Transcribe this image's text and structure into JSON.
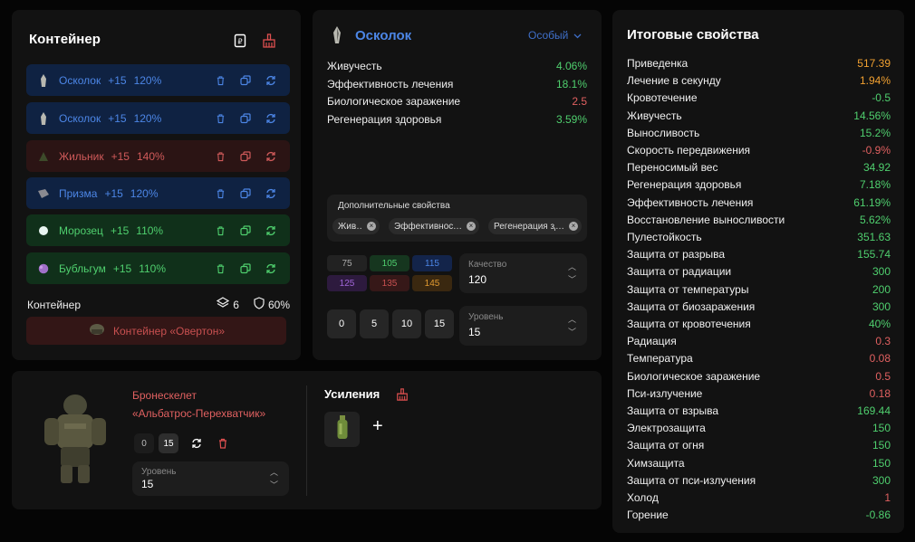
{
  "container": {
    "title": "Контейнер",
    "artifacts": [
      {
        "name": "Осколок",
        "level": "+15",
        "percent": "120%",
        "color": "blue"
      },
      {
        "name": "Осколок",
        "level": "+15",
        "percent": "120%",
        "color": "blue"
      },
      {
        "name": "Жильник",
        "level": "+15",
        "percent": "140%",
        "color": "red"
      },
      {
        "name": "Призма",
        "level": "+15",
        "percent": "120%",
        "color": "blue"
      },
      {
        "name": "Морозец",
        "level": "+15",
        "percent": "110%",
        "color": "green"
      },
      {
        "name": "Бубльгум",
        "level": "+15",
        "percent": "110%",
        "color": "green"
      }
    ],
    "footer_label": "Контейнер",
    "slots": "6",
    "protection": "60%",
    "container_button": "Контейнер «Овертон»"
  },
  "item": {
    "name": "Осколок",
    "rarity": "Особый",
    "stats": [
      {
        "label": "Живучесть",
        "value": "4.06%",
        "tone": "g"
      },
      {
        "label": "Эффективность лечения",
        "value": "18.1%",
        "tone": "g"
      },
      {
        "label": "Биологическое заражение",
        "value": "2.5",
        "tone": "r"
      },
      {
        "label": "Регенерация здоровья",
        "value": "3.59%",
        "tone": "g"
      }
    ],
    "additional_title": "Дополнительные свойства",
    "chips": [
      "Живучесть",
      "Эффективность лечения",
      "Регенерация здоровья"
    ],
    "quality_buttons": [
      "75",
      "105",
      "115",
      "125",
      "135",
      "145"
    ],
    "quality_label": "Качество",
    "quality_value": "120",
    "level_buttons": [
      "0",
      "5",
      "10",
      "15"
    ],
    "level_label": "Уровень",
    "level_value": "15"
  },
  "armor": {
    "name_line1": "Бронескелет",
    "name_line2": "«Альбатрос-Перехватчик»",
    "buttons": [
      "0",
      "15"
    ],
    "level_label": "Уровень",
    "level_value": "15",
    "boosts_title": "Усиления",
    "add_symbol": "+"
  },
  "totals": {
    "title": "Итоговые свойства",
    "rows": [
      {
        "label": "Приведенка",
        "value": "517.39",
        "tone": "o"
      },
      {
        "label": "Лечение в секунду",
        "value": "1.94%",
        "tone": "o"
      },
      {
        "label": "Кровотечение",
        "value": "-0.5",
        "tone": "g"
      },
      {
        "label": "Живучесть",
        "value": "14.56%",
        "tone": "g"
      },
      {
        "label": "Выносливость",
        "value": "15.2%",
        "tone": "g"
      },
      {
        "label": "Скорость передвижения",
        "value": "-0.9%",
        "tone": "r"
      },
      {
        "label": "Переносимый вес",
        "value": "34.92",
        "tone": "g"
      },
      {
        "label": "Регенерация здоровья",
        "value": "7.18%",
        "tone": "g"
      },
      {
        "label": "Эффективность лечения",
        "value": "61.19%",
        "tone": "g"
      },
      {
        "label": "Восстановление выносливости",
        "value": "5.62%",
        "tone": "g"
      },
      {
        "label": "Пулестойкость",
        "value": "351.63",
        "tone": "g"
      },
      {
        "label": "Защита от разрыва",
        "value": "155.74",
        "tone": "g"
      },
      {
        "label": "Защита от радиации",
        "value": "300",
        "tone": "g"
      },
      {
        "label": "Защита от температуры",
        "value": "200",
        "tone": "g"
      },
      {
        "label": "Защита от биозаражения",
        "value": "300",
        "tone": "g"
      },
      {
        "label": "Защита от кровотечения",
        "value": "40%",
        "tone": "g"
      },
      {
        "label": "Радиация",
        "value": "0.3",
        "tone": "r"
      },
      {
        "label": "Температура",
        "value": "0.08",
        "tone": "r"
      },
      {
        "label": "Биологическое заражение",
        "value": "0.5",
        "tone": "r"
      },
      {
        "label": "Пси-излучение",
        "value": "0.18",
        "tone": "r"
      },
      {
        "label": "Защита от взрыва",
        "value": "169.44",
        "tone": "g"
      },
      {
        "label": "Электрозащита",
        "value": "150",
        "tone": "g"
      },
      {
        "label": "Защита от огня",
        "value": "150",
        "tone": "g"
      },
      {
        "label": "Химзащита",
        "value": "150",
        "tone": "g"
      },
      {
        "label": "Защита от пси-излучения",
        "value": "300",
        "tone": "g"
      },
      {
        "label": "Холод",
        "value": "1",
        "tone": "r"
      },
      {
        "label": "Горение",
        "value": "-0.86",
        "tone": "g"
      }
    ]
  }
}
